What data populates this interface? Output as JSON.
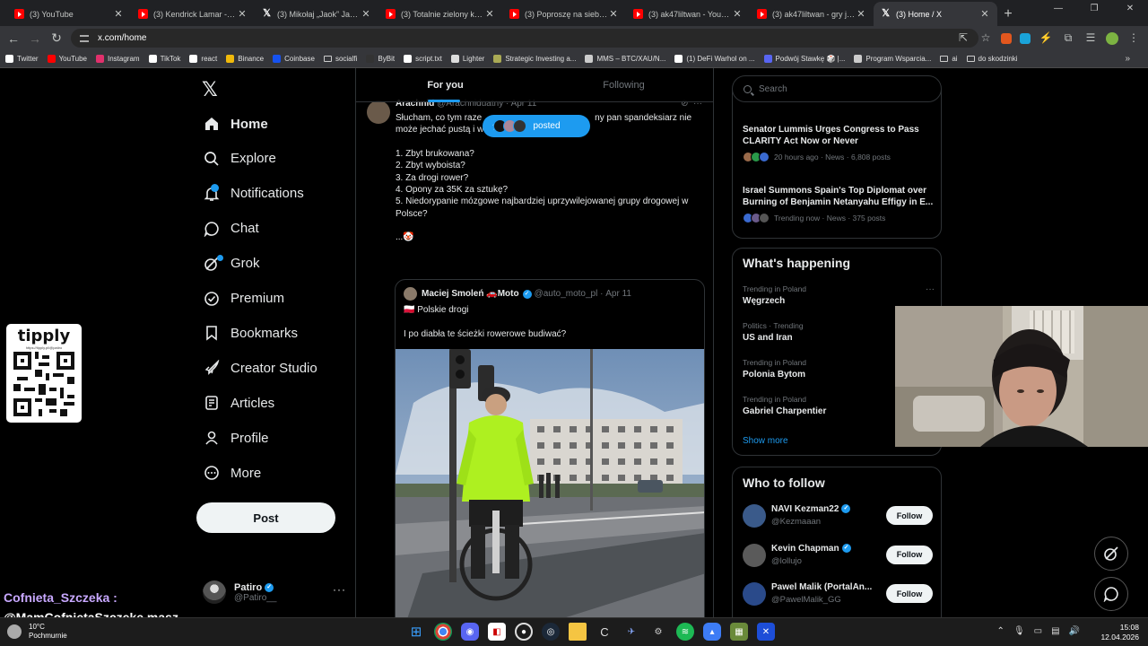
{
  "browser": {
    "tabs": [
      {
        "title": "(3) YouTube",
        "icon": "youtube"
      },
      {
        "title": "(3) Kendrick Lamar - King",
        "icon": "youtube"
      },
      {
        "title": "(3) Mikołaj „Jaok” Janusz",
        "icon": "x"
      },
      {
        "title": "(3) Totalnie zielony kursan",
        "icon": "youtube"
      },
      {
        "title": "(3) Poproszę na siebie - Yo",
        "icon": "youtube"
      },
      {
        "title": "(3) ak47liltwan - YouTube",
        "icon": "youtube"
      },
      {
        "title": "(3) ak47liltwan - gry jeja b",
        "icon": "youtube"
      },
      {
        "title": "(3) Home / X",
        "icon": "x",
        "active": true
      }
    ],
    "new_tab": "+",
    "address": "x.com/home",
    "bookmarks": [
      {
        "label": "Twitter",
        "icon": "x-icon",
        "color": "#ffffff"
      },
      {
        "label": "YouTube",
        "icon": "youtube-icon",
        "color": "#ff0000"
      },
      {
        "label": "Instagram",
        "icon": "instagram-icon",
        "color": "#e1306c"
      },
      {
        "label": "TikTok",
        "icon": "tiktok-icon",
        "color": "#ffffff"
      },
      {
        "label": "react",
        "icon": "tiktok-icon",
        "color": "#ffffff"
      },
      {
        "label": "Binance",
        "icon": "binance-icon",
        "color": "#f0b90b"
      },
      {
        "label": "Coinbase",
        "icon": "coinbase-icon",
        "color": "#1652f0"
      },
      {
        "label": "socialfi",
        "icon": "folder-icon",
        "color": "#cccccc"
      },
      {
        "label": "ByBit",
        "icon": "bybit-icon",
        "color": "#333333"
      },
      {
        "label": "script.txt",
        "icon": "github-icon",
        "color": "#ffffff"
      },
      {
        "label": "Lighter",
        "icon": "lighter-icon",
        "color": "#dddddd"
      },
      {
        "label": "Strategic Investing a...",
        "icon": "loading-icon",
        "color": "#aaaa55"
      },
      {
        "label": "MMS – BTC/XAU/N...",
        "icon": "globe-icon",
        "color": "#cccccc"
      },
      {
        "label": "(1) DeFi Warhol on ...",
        "icon": "x-icon",
        "color": "#ffffff"
      },
      {
        "label": "Podwój Stawkę 🎲 |...",
        "icon": "discord-icon",
        "color": "#5865f2"
      },
      {
        "label": "Program Wsparcia...",
        "icon": "bookmark-icon",
        "color": "#cccccc"
      },
      {
        "label": "ai",
        "icon": "folder-icon",
        "color": "#cccccc"
      },
      {
        "label": "do skodzinki",
        "icon": "folder-icon",
        "color": "#cccccc"
      }
    ]
  },
  "sidebar": {
    "items": [
      {
        "label": "Home",
        "icon": "home-icon",
        "bold": true
      },
      {
        "label": "Explore",
        "icon": "search-icon"
      },
      {
        "label": "Notifications",
        "icon": "bell-icon",
        "badge": "3"
      },
      {
        "label": "Chat",
        "icon": "chat-icon"
      },
      {
        "label": "Grok",
        "icon": "grok-icon",
        "dot": true
      },
      {
        "label": "Premium",
        "icon": "premium-icon"
      },
      {
        "label": "Bookmarks",
        "icon": "bookmark-icon"
      },
      {
        "label": "Creator Studio",
        "icon": "rocket-icon"
      },
      {
        "label": "Articles",
        "icon": "articles-icon"
      },
      {
        "label": "Profile",
        "icon": "person-icon"
      },
      {
        "label": "More",
        "icon": "more-circle-icon"
      }
    ],
    "post_label": "Post",
    "account": {
      "name": "Patiro",
      "handle": "@Patiro__"
    }
  },
  "feed": {
    "tabs": [
      "For you",
      "Following"
    ],
    "posted_pill": "posted",
    "tweet": {
      "name": "Arachnid",
      "handle": "@Arachniduatny",
      "time": "Apr 11",
      "line1_a": "Słucham, co tym raze",
      "line1_b": "ny pan spandeksiarz nie",
      "line2": "może jechać pustą i w",
      "list": [
        "1. Zbyt brukowana?",
        "2. Zbyt wyboista?",
        "3. Za drogi rower?",
        "4. Opony za 35K za sztukę?",
        "5. Niedorypanie mózgowe najbardziej uprzywilejowanej grupy drogowej w Polsce?"
      ],
      "ending": "...🤡",
      "quote": {
        "name": "Maciej Smoleń 🚗Moto",
        "handle": "@auto_moto_pl",
        "time": "Apr 11",
        "line1": "🇵🇱 Polskie drogi",
        "line2": "I po diabła te ścieżki rowerowe budiwać?"
      }
    }
  },
  "right": {
    "search_placeholder": "Search",
    "news": [
      {
        "headline": "Senator Lummis Urges Congress to Pass CLARITY Act Now or Never",
        "meta": "20 hours ago · News · 6,808 posts"
      },
      {
        "headline": "Israel Summons Spain's Top Diplomat over Burning of Benjamin Netanyahu Effigy in E...",
        "meta": "Trending now · News · 375 posts"
      }
    ],
    "happening_title": "What's happening",
    "trends": [
      {
        "context": "Trending in Poland",
        "title": "Węgrzech"
      },
      {
        "context": "Politics · Trending",
        "title": "US and Iran"
      },
      {
        "context": "Trending in Poland",
        "title": "Polonia Bytom"
      },
      {
        "context": "Trending in Poland",
        "title": "Gabriel Charpentier"
      }
    ],
    "show_more": "Show more",
    "who_title": "Who to follow",
    "follow": [
      {
        "name": "NAVI Kezman22",
        "handle": "@Kezmaaan",
        "button": "Follow",
        "color": "#3a5a8a"
      },
      {
        "name": "Kevin Chapman",
        "handle": "@lollujo",
        "button": "Follow",
        "color": "#5a5a5a"
      },
      {
        "name": "Pawel Malik (PortalAn...",
        "handle": "@PawelMalik_GG",
        "button": "Follow",
        "color": "#2a4a8a"
      }
    ]
  },
  "overlay": {
    "tipply_logo": "tipply",
    "tipply_url": "https://tipply.pl/@patiro",
    "chat_user": "Cofnieta_Szczeka :",
    "chat_message": "@MamCofnietaSzczeke masz"
  },
  "taskbar": {
    "temp": "10°C",
    "weather": "Pochmurnie",
    "time": "15:08",
    "date": "12.04.2026"
  },
  "colors": {
    "accent": "#1d9bf0",
    "border": "#2f3336",
    "muted": "#71767b"
  }
}
